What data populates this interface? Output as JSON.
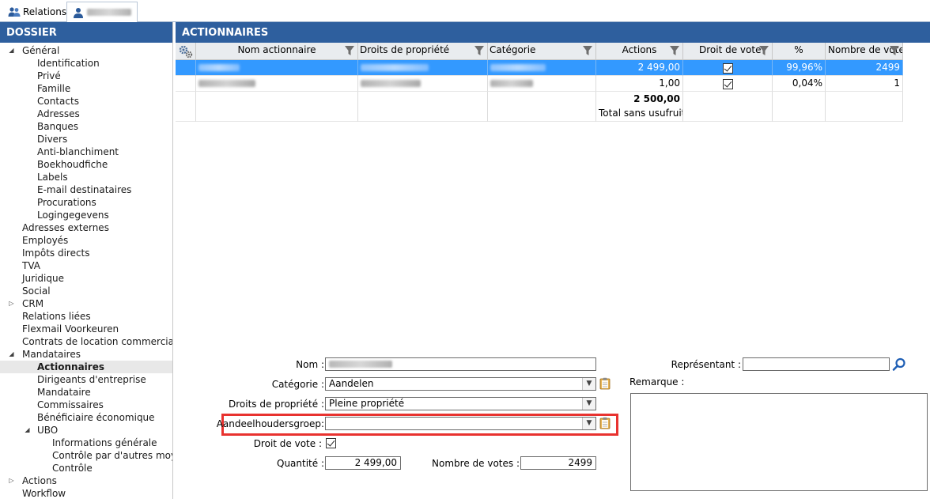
{
  "tabs": [
    {
      "label": "Relations",
      "icon": "people-icon"
    },
    {
      "label": "",
      "icon": "person-icon"
    }
  ],
  "left_panel": {
    "title": "DOSSIER",
    "tree": [
      {
        "label": "Général",
        "level": 0,
        "expander": "expanded"
      },
      {
        "label": "Identification",
        "level": 1
      },
      {
        "label": "Privé",
        "level": 1
      },
      {
        "label": "Famille",
        "level": 1
      },
      {
        "label": "Contacts",
        "level": 1
      },
      {
        "label": "Adresses",
        "level": 1
      },
      {
        "label": "Banques",
        "level": 1
      },
      {
        "label": "Divers",
        "level": 1
      },
      {
        "label": "Anti-blanchiment",
        "level": 1
      },
      {
        "label": "Boekhoudfiche",
        "level": 1
      },
      {
        "label": "Labels",
        "level": 1
      },
      {
        "label": "E-mail destinataires",
        "level": 1
      },
      {
        "label": "Procurations",
        "level": 1
      },
      {
        "label": "Logingegevens",
        "level": 1
      },
      {
        "label": "Adresses externes",
        "level": 0
      },
      {
        "label": "Employés",
        "level": 0
      },
      {
        "label": "Impôts directs",
        "level": 0
      },
      {
        "label": "TVA",
        "level": 0
      },
      {
        "label": "Juridique",
        "level": 0
      },
      {
        "label": "Social",
        "level": 0
      },
      {
        "label": "CRM",
        "level": 0,
        "expander": "collapsed"
      },
      {
        "label": "Relations liées",
        "level": 0
      },
      {
        "label": "Flexmail Voorkeuren",
        "level": 0
      },
      {
        "label": "Contrats de location commerciale",
        "level": 0
      },
      {
        "label": "Mandataires",
        "level": 0,
        "expander": "expanded"
      },
      {
        "label": "Actionnaires",
        "level": 1,
        "selected": true
      },
      {
        "label": "Dirigeants d'entreprise",
        "level": 1
      },
      {
        "label": "Mandataire",
        "level": 1
      },
      {
        "label": "Commissaires",
        "level": 1
      },
      {
        "label": "Bénéficiaire économique",
        "level": 1
      },
      {
        "label": "UBO",
        "level": 1,
        "expander": "expanded"
      },
      {
        "label": "Informations générale",
        "level": 2
      },
      {
        "label": "Contrôle par d'autres moy",
        "level": 2
      },
      {
        "label": "Contrôle",
        "level": 2
      },
      {
        "label": "Actions",
        "level": 0,
        "expander": "collapsed"
      },
      {
        "label": "Workflow",
        "level": 0
      }
    ]
  },
  "right_panel": {
    "title": "ACTIONNAIRES",
    "grid": {
      "columns": [
        "Nom actionnaire",
        "Droits de propriété",
        "Catégorie",
        "Actions",
        "Droit de vote",
        "%",
        "Nombre de votes"
      ],
      "rows": [
        {
          "actions": "2 499,00",
          "droit_de_vote": true,
          "percent": "99,96%",
          "votes": "2499",
          "selected": true
        },
        {
          "actions": "1,00",
          "droit_de_vote": true,
          "percent": "0,04%",
          "votes": "1",
          "selected": false
        }
      ],
      "total_value": "2 500,00",
      "total_label": "Total sans usufruit"
    },
    "form": {
      "nom_label": "Nom :",
      "nom_value": "",
      "categorie_label": "Catégorie :",
      "categorie_value": "Aandelen",
      "droits_label": "Droits de propriété :",
      "droits_value": "Pleine propriété",
      "groep_label": "Aandeelhoudersgroep:",
      "groep_value": "",
      "droit_vote_label": "Droit de vote :",
      "droit_vote_checked": true,
      "quantite_label": "Quantité :",
      "quantite_value": "2 499,00",
      "nombre_votes_label": "Nombre de votes :",
      "nombre_votes_value": "2499",
      "representant_label": "Représentant :",
      "representant_value": "",
      "remarque_label": "Remarque :",
      "remarque_value": ""
    }
  },
  "colors": {
    "header_blue": "#2e5f9e",
    "selection_blue": "#3399ff",
    "highlight_red": "#e8322f"
  }
}
